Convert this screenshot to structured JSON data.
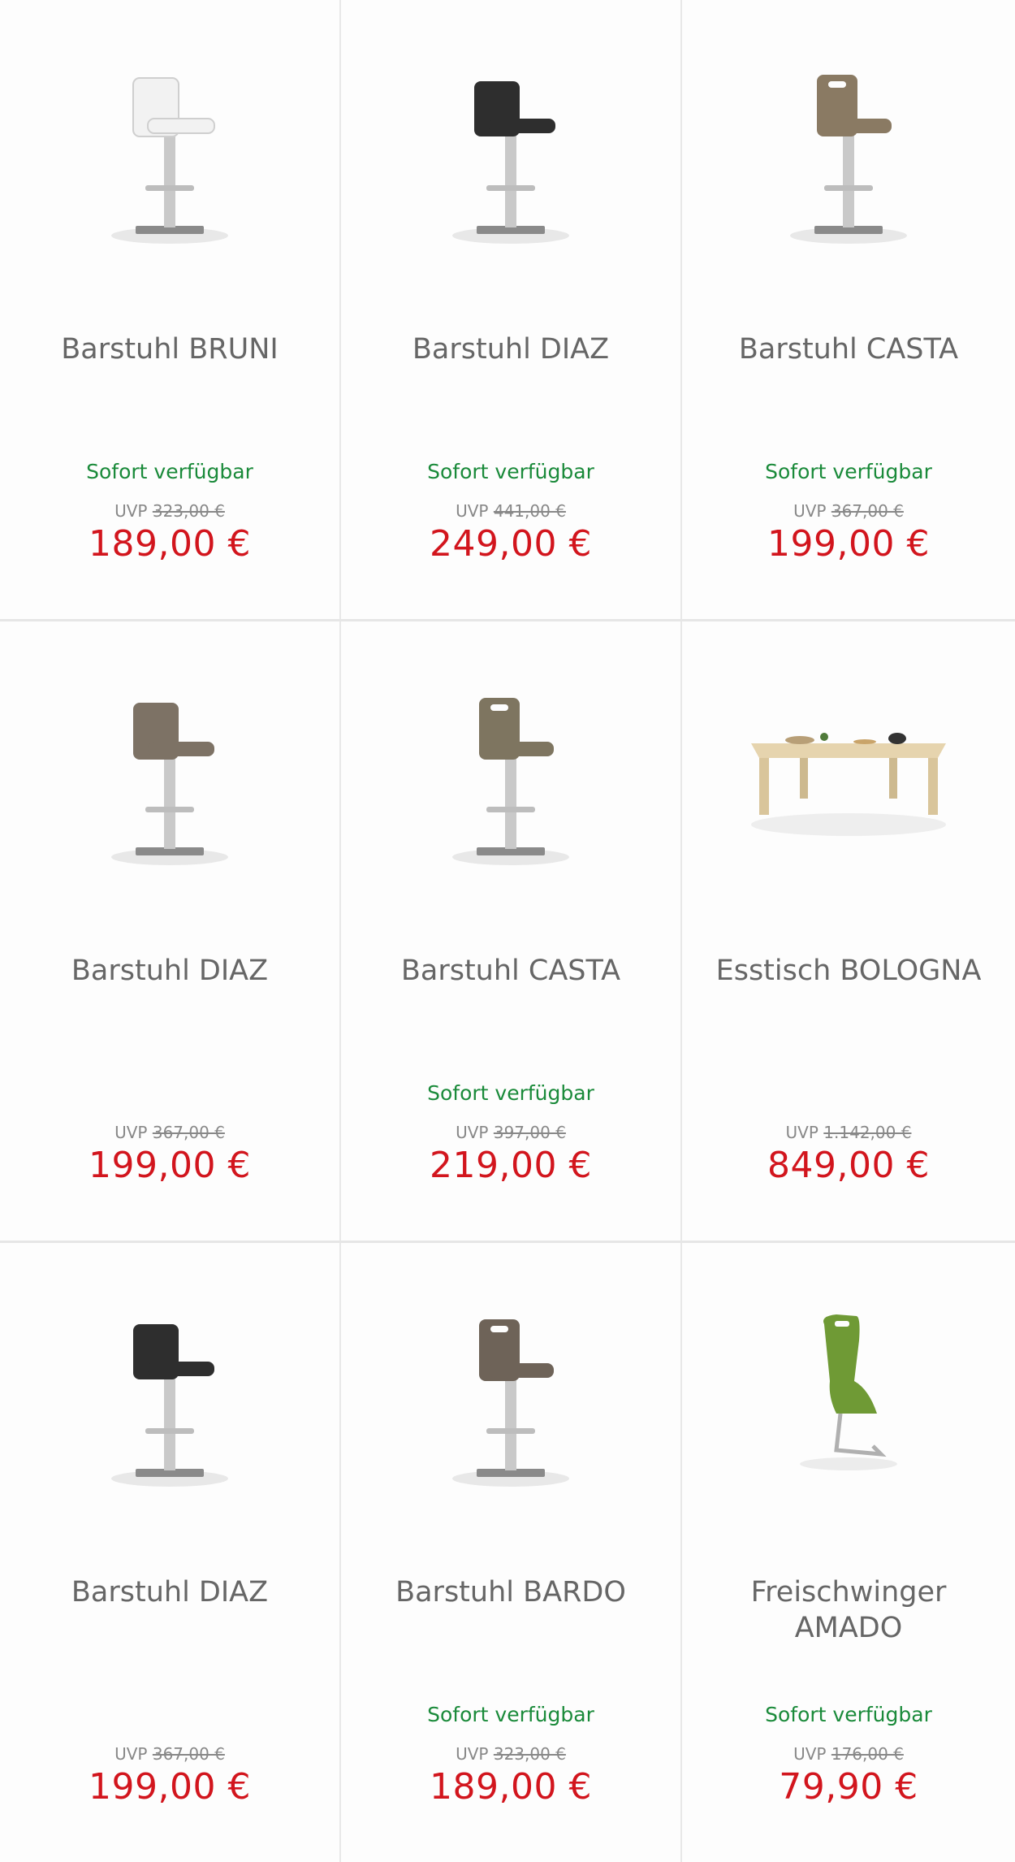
{
  "products": [
    {
      "title": "Barstuhl BRUNI",
      "availability": "Sofort verfügbar",
      "uvp_label": "UVP",
      "uvp": "323,00 €",
      "price": "189,00 €",
      "image": "barstool-white",
      "color": "#eeeeee"
    },
    {
      "title": "Barstuhl DIAZ",
      "availability": "Sofort verfügbar",
      "uvp_label": "UVP",
      "uvp": "441,00 €",
      "price": "249,00 €",
      "image": "barstool-black",
      "color": "#2e2e2e"
    },
    {
      "title": "Barstuhl CASTA",
      "availability": "Sofort verfügbar",
      "uvp_label": "UVP",
      "uvp": "367,00 €",
      "price": "199,00 €",
      "image": "barstool-handle-cappuccino",
      "color": "#8a7a63"
    },
    {
      "title": "Barstuhl DIAZ",
      "availability": "",
      "uvp_label": "UVP",
      "uvp": "367,00 €",
      "price": "199,00 €",
      "image": "barstool-cappuccino",
      "color": "#7d7265"
    },
    {
      "title": "Barstuhl CASTA",
      "availability": "Sofort verfügbar",
      "uvp_label": "UVP",
      "uvp": "397,00 €",
      "price": "219,00 €",
      "image": "barstool-handle-olive",
      "color": "#7e7560"
    },
    {
      "title": "Esstisch BOLOGNA",
      "availability": "",
      "uvp_label": "UVP",
      "uvp": "1.142,00 €",
      "price": "849,00 €",
      "image": "dining-table",
      "color": "#e1cfa8"
    },
    {
      "title": "Barstuhl DIAZ",
      "availability": "",
      "uvp_label": "UVP",
      "uvp": "367,00 €",
      "price": "199,00 €",
      "image": "barstool-black",
      "color": "#2e2e2e"
    },
    {
      "title": "Barstuhl BARDO",
      "availability": "Sofort verfügbar",
      "uvp_label": "UVP",
      "uvp": "323,00 €",
      "price": "189,00 €",
      "image": "barstool-handle-taupe",
      "color": "#6e6358"
    },
    {
      "title": "Freischwinger AMADO",
      "availability": "Sofort verfügbar",
      "uvp_label": "UVP",
      "uvp": "176,00 €",
      "price": "79,90 €",
      "image": "cantilever-chair-green",
      "color": "#6f9a35"
    }
  ]
}
